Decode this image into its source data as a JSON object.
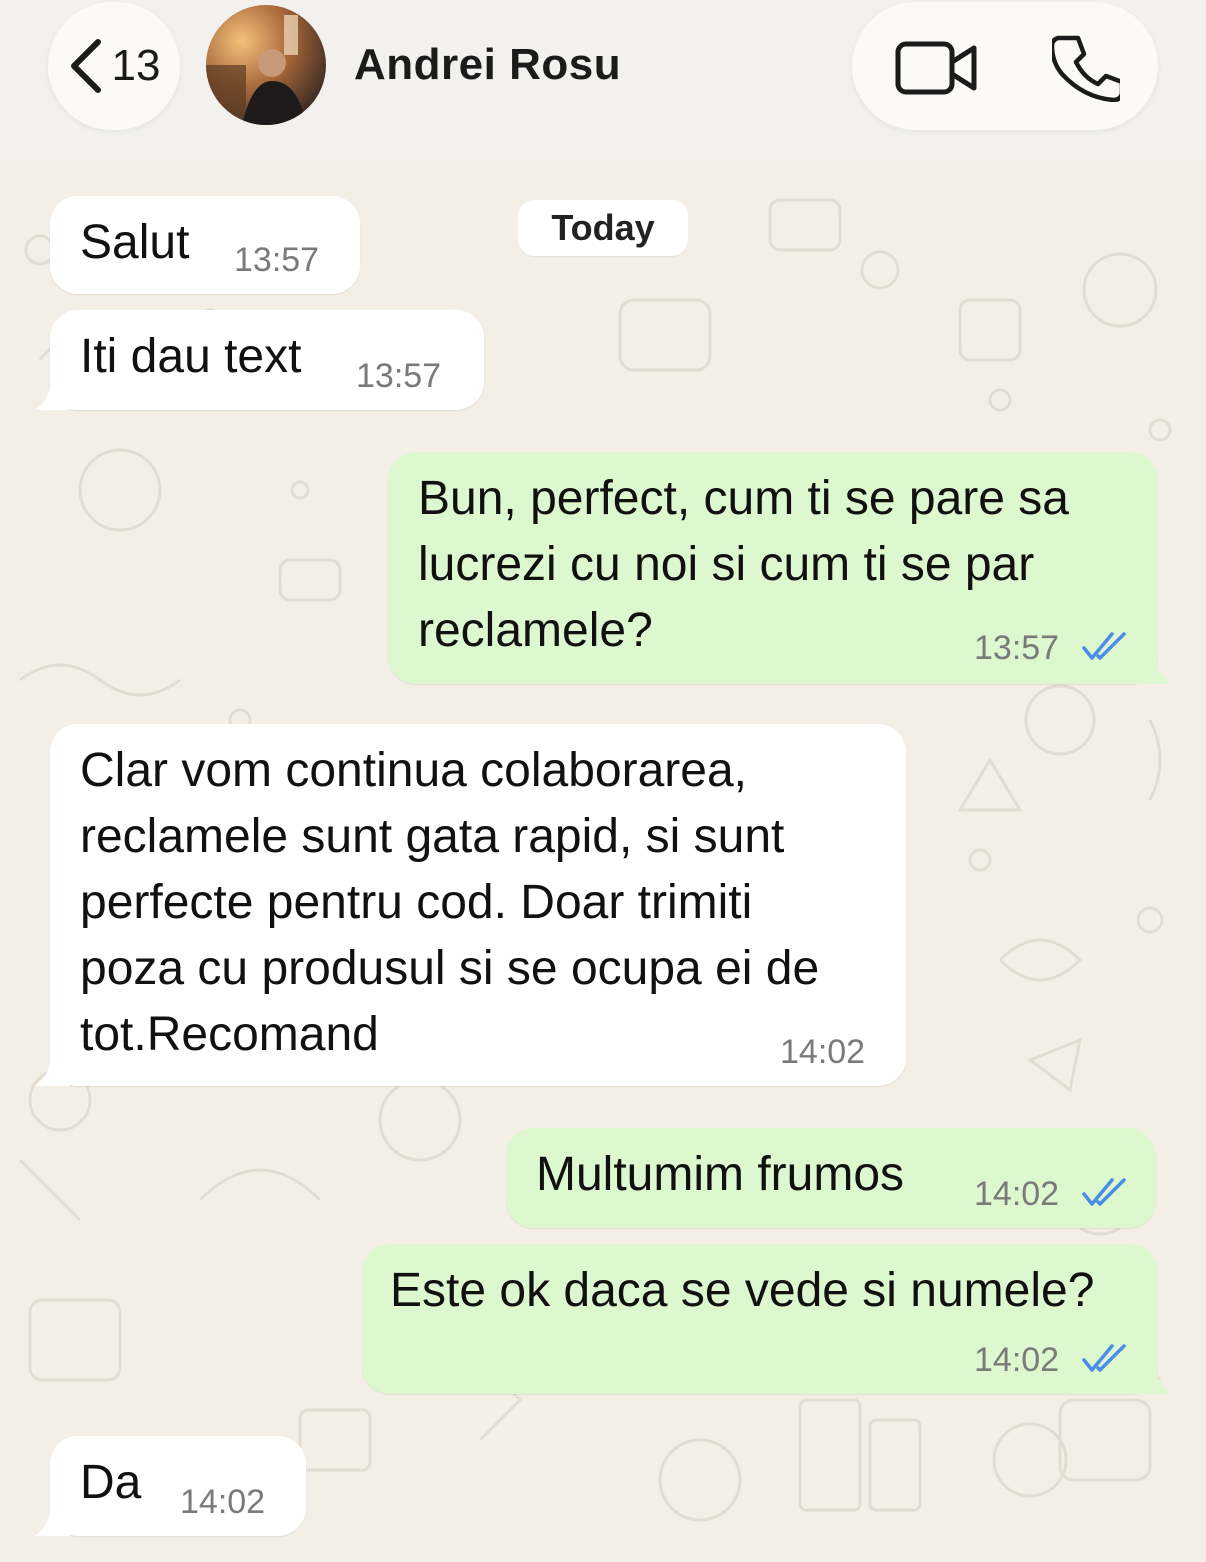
{
  "header": {
    "back_count": "13",
    "contact_name": "Andrei Rosu"
  },
  "date_separator": "Today",
  "messages": [
    {
      "text": "Salut",
      "time": "13:57",
      "direction": "incoming"
    },
    {
      "text": "Iti dau text",
      "time": "13:57",
      "direction": "incoming"
    },
    {
      "text": "Bun, perfect, cum ti se pare sa\nlucrezi cu noi si cum ti se par\nreclamele?",
      "time": "13:57",
      "direction": "outgoing",
      "status": "read"
    },
    {
      "text": "Clar vom continua colaborarea,\nreclamele sunt gata rapid, si sunt\nperfecte pentru cod. Doar trimiti\npoza cu produsul si se ocupa ei de\ntot.Recomand",
      "time": "14:02",
      "direction": "incoming"
    },
    {
      "text": "Multumim frumos",
      "time": "14:02",
      "direction": "outgoing",
      "status": "read"
    },
    {
      "text": "Este ok daca se vede si numele?",
      "time": "14:02",
      "direction": "outgoing",
      "status": "read"
    },
    {
      "text": "Da",
      "time": "14:02",
      "direction": "incoming"
    }
  ],
  "colors": {
    "incoming_bubble": "#ffffff",
    "outgoing_bubble": "#ddf7cf",
    "read_ticks": "#4a8ee8"
  },
  "icons": [
    "chevron-left-icon",
    "video-call-icon",
    "phone-icon",
    "read-ticks-icon"
  ]
}
